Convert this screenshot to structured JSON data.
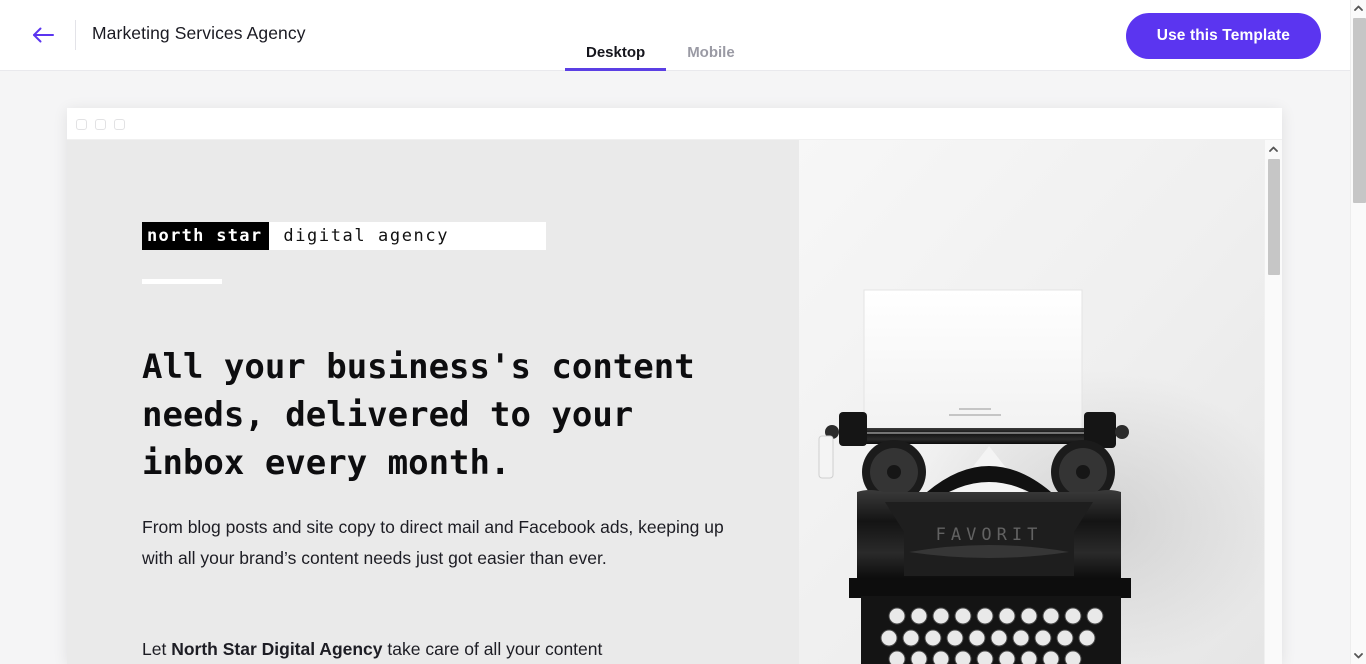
{
  "header": {
    "back_icon": "arrow-left-icon",
    "title": "Marketing Services Agency",
    "tabs": [
      {
        "label": "Desktop",
        "active": true
      },
      {
        "label": "Mobile",
        "active": false
      }
    ],
    "cta_label": "Use this Template",
    "accent_color": "#5b35f0",
    "tab_underline_color": "#5b3fe4"
  },
  "preview": {
    "chrome": {
      "dot_count": 3,
      "dot_border_color": "#e2e2e4"
    },
    "site": {
      "background_color": "#eaeaea",
      "logo": {
        "mark_text": "north star",
        "mark_bg": "#000000",
        "mark_fg": "#ffffff",
        "sub_text": "digital agency",
        "sub_fg": "#111111",
        "lockup_bg": "#ffffff"
      },
      "rule_color": "#ffffff",
      "heading": "All your business's content needs, delivered to your inbox every month.",
      "paragraph_1": "From blog posts and site copy to direct mail and Facebook ads, keeping up with all your brand’s content needs just got easier than ever.",
      "paragraph_2_prefix": "Let ",
      "paragraph_2_bold": "North Star Digital Agency",
      "paragraph_2_suffix": " take care of all your content",
      "hero_image": {
        "name": "vintage-typewriter-photo",
        "alt": "Black and white vintage FAVORIT typewriter with blank paper",
        "brand_plate_text": "FAVORIT"
      }
    },
    "inner_scrollbar": {
      "up_arrow_icon": "chevron-up-icon",
      "thumb_color": "#c6c6c6"
    }
  },
  "page_scrollbar": {
    "up_arrow_icon": "chevron-up-icon",
    "down_arrow_icon": "chevron-down-icon",
    "thumb_color": "#c6c6c6"
  }
}
